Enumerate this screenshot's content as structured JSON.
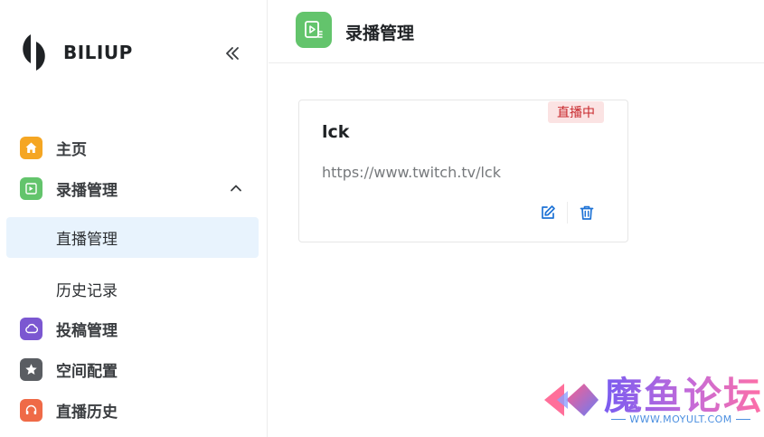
{
  "brand": {
    "name": "BILIUP"
  },
  "sidebar": {
    "items": [
      {
        "label": "主页",
        "icon": "home-icon",
        "color": "#f5a623"
      },
      {
        "label": "录播管理",
        "icon": "record-icon",
        "color": "#63c46c"
      },
      {
        "label": "投稿管理",
        "icon": "cloud-icon",
        "color": "#7b57d1"
      },
      {
        "label": "空间配置",
        "icon": "star-icon",
        "color": "#5a5d62"
      },
      {
        "label": "直播历史",
        "icon": "headset-icon",
        "color": "#ef6a47"
      }
    ],
    "sub_items": [
      {
        "label": "直播管理",
        "active": true
      },
      {
        "label": "历史记录",
        "active": false
      }
    ]
  },
  "header": {
    "title": "录播管理"
  },
  "card": {
    "title": "lck",
    "badge": "直播中",
    "url": "https://www.twitch.tv/lck",
    "accent": "#1e73d6"
  },
  "watermark": {
    "text": "魔鱼论坛",
    "url": "WWW.MOYULT.COM"
  }
}
